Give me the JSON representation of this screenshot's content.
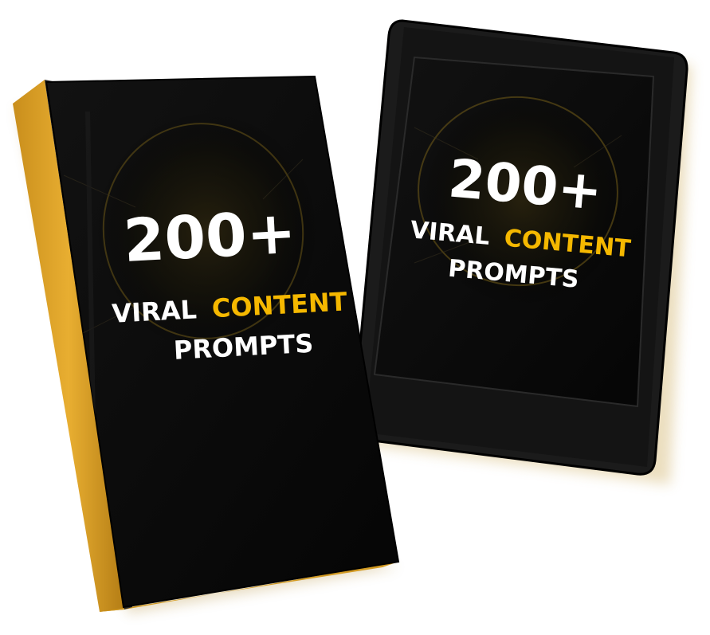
{
  "book": {
    "number": "200+",
    "line1_white": "VIRAL",
    "line1_accent": "CONTENT",
    "line2": "PROMPTS"
  },
  "tablet": {
    "number": "200+",
    "line1_white": "VIRAL",
    "line1_accent": "CONTENT",
    "line2": "PROMPTS"
  },
  "colors": {
    "accent": "#f5b800",
    "page_edge": "#e0a62a",
    "cover": "#0b0b0b",
    "text": "#ffffff",
    "background": "#ffffff"
  }
}
